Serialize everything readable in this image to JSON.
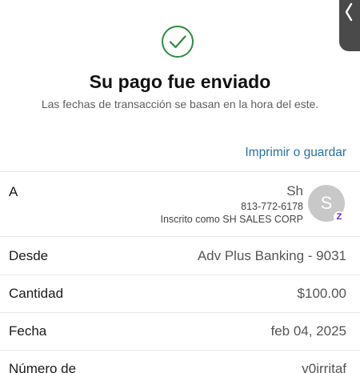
{
  "header": {
    "title": "Su pago fue enviado",
    "subtitle": "Las fechas de transacción se basan en la hora del este.",
    "print_link": "Imprimir o guardar"
  },
  "recipient": {
    "label": "A",
    "name": "Sh",
    "phone": "813-772-6178",
    "enrolled_as": "Inscrito como SH SALES CORP",
    "avatar_initial": "S",
    "badge_glyph": "Z"
  },
  "details": {
    "from_label": "Desde",
    "from_value": "Adv Plus Banking - 9031",
    "amount_label": "Cantidad",
    "amount_value": "$100.00",
    "date_label": "Fecha",
    "date_value": "feb 04, 2025",
    "confirmation_label": "Número de",
    "confirmation_value": "v0irritaf"
  },
  "colors": {
    "success_green": "#2e8b3e",
    "link_blue": "#2a6fa8",
    "zelle_purple": "#6d1ed4"
  },
  "icons": {
    "success": "check-circle-icon",
    "side_handle": "chevron-left-icon",
    "badge": "zelle-icon"
  }
}
